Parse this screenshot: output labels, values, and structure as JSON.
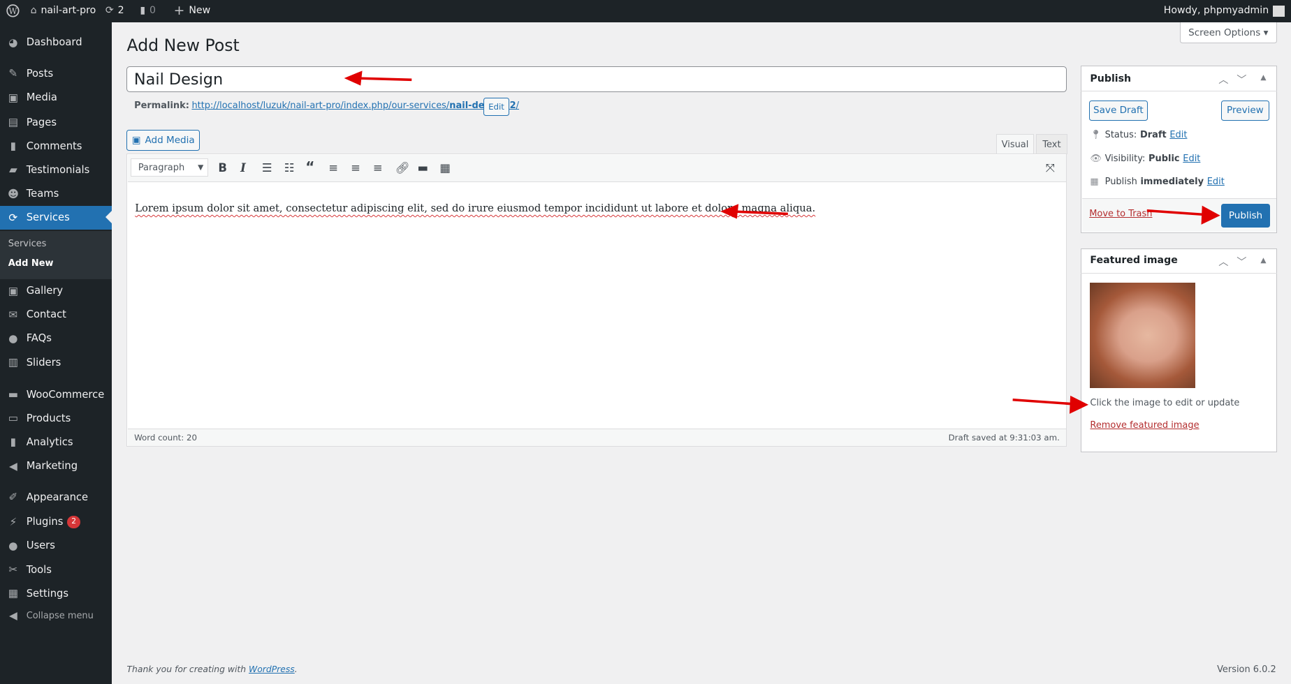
{
  "adminbar": {
    "site": "nail-art-pro",
    "updates": "2",
    "comments": "0",
    "new": "New",
    "howdy": "Howdy, phpmyadmin"
  },
  "sidebar": {
    "items": [
      {
        "label": "Dashboard",
        "icon": "dashboard-icon"
      },
      {
        "label": "Posts",
        "icon": "pin-icon"
      },
      {
        "label": "Media",
        "icon": "media-icon"
      },
      {
        "label": "Pages",
        "icon": "pages-icon"
      },
      {
        "label": "Comments",
        "icon": "comment-icon"
      },
      {
        "label": "Testimonials",
        "icon": "testimonials-icon"
      },
      {
        "label": "Teams",
        "icon": "groups-icon"
      },
      {
        "label": "Services",
        "icon": "refresh-icon"
      },
      {
        "label": "Gallery",
        "icon": "gallery-icon"
      },
      {
        "label": "Contact",
        "icon": "email-icon"
      },
      {
        "label": "FAQs",
        "icon": "chat-icon"
      },
      {
        "label": "Sliders",
        "icon": "slides-icon"
      },
      {
        "label": "WooCommerce",
        "icon": "woo-icon"
      },
      {
        "label": "Products",
        "icon": "archive-icon"
      },
      {
        "label": "Analytics",
        "icon": "chart-icon"
      },
      {
        "label": "Marketing",
        "icon": "megaphone-icon"
      },
      {
        "label": "Appearance",
        "icon": "brush-icon"
      },
      {
        "label": "Plugins",
        "icon": "plugin-icon",
        "badge": "2"
      },
      {
        "label": "Users",
        "icon": "user-icon"
      },
      {
        "label": "Tools",
        "icon": "wrench-icon"
      },
      {
        "label": "Settings",
        "icon": "settings-icon"
      }
    ],
    "submenu": [
      "Services",
      "Add New"
    ],
    "collapse": "Collapse menu"
  },
  "screen_options": "Screen Options",
  "page_title": "Add New Post",
  "post_title": "Nail Design",
  "permalink": {
    "label": "Permalink:",
    "url_prefix": "http://localhost/luzuk/nail-art-pro/index.php/our-services/",
    "slug": "nail-design-2",
    "url_suffix": "/",
    "edit": "Edit"
  },
  "add_media": "Add Media",
  "editor": {
    "tab_visual": "Visual",
    "tab_text": "Text",
    "format": "Paragraph",
    "content": "Lorem ipsum dolor sit amet, consectetur adipiscing elit, sed do irure eiusmod tempor incididunt ut labore et dolore magna aliqua.",
    "word_count": "Word count: 20",
    "draft_saved": "Draft saved at 9:31:03 am."
  },
  "publish": {
    "title": "Publish",
    "save_draft": "Save Draft",
    "preview": "Preview",
    "status_label": "Status:",
    "status": "Draft",
    "visibility_label": "Visibility:",
    "visibility": "Public",
    "publish_label": "Publish",
    "publish_when": "immediately",
    "edit": "Edit",
    "trash": "Move to Trash",
    "publish_btn": "Publish"
  },
  "featured": {
    "title": "Featured image",
    "hint": "Click the image to edit or update",
    "remove": "Remove featured image"
  },
  "footer": {
    "thanks": "Thank you for creating with ",
    "wp": "WordPress",
    "period": ".",
    "version": "Version 6.0.2"
  },
  "colors": {
    "accent": "#2271b1",
    "adminbar": "#1d2327",
    "arrow": "#e00000"
  }
}
